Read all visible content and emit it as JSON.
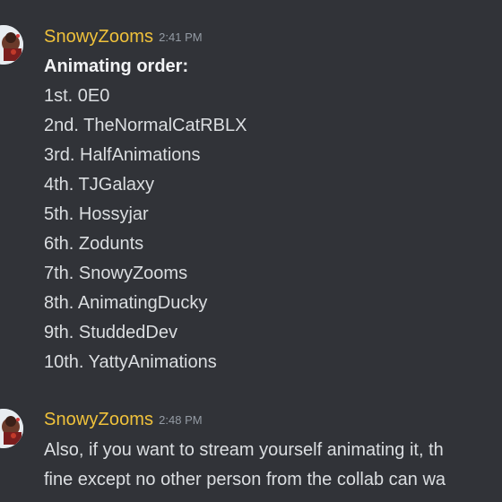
{
  "messages": [
    {
      "username": "SnowyZooms",
      "timestamp": "2:41 PM",
      "heading": "Animating order:",
      "lines": [
        "1st. 0E0",
        "2nd. TheNormalCatRBLX",
        "3rd. HalfAnimations",
        "4th. TJGalaxy",
        "5th. Hossyjar",
        "6th. Zodunts",
        "7th. SnowyZooms",
        "8th. AnimatingDucky",
        "9th. StuddedDev",
        "10th. YattyAnimations"
      ]
    },
    {
      "username": "SnowyZooms",
      "timestamp": "2:48 PM",
      "text_lines": [
        "Also, if you want to stream yourself animating it, th",
        "fine except no other person from the collab can wa"
      ]
    }
  ],
  "colors": {
    "background": "#313338",
    "username": "#f0c23b",
    "timestamp": "#949ba4",
    "text": "#dbdee1"
  }
}
